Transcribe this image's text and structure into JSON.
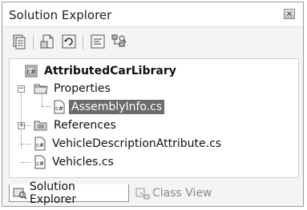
{
  "window": {
    "title": "Solution Explorer",
    "close_glyph": "×"
  },
  "toolbar": {
    "buttons": [
      {
        "icon": "properties-icon"
      },
      {
        "icon": "show-all-files-icon"
      },
      {
        "icon": "refresh-icon"
      },
      {
        "icon": "view-code-icon"
      },
      {
        "icon": "class-diagram-icon"
      }
    ]
  },
  "tree": {
    "project": "AttributedCarLibrary",
    "properties": "Properties",
    "assemblyinfo": "AssemblyInfo.cs",
    "references": "References",
    "file1": "VehicleDescriptionAttribute.cs",
    "file2": "Vehicles.cs",
    "collapse_glyph": "−",
    "expand_glyph": "+"
  },
  "tabs": {
    "solution_explorer": "Solution Explorer",
    "class_view": "Class View"
  },
  "colors": {
    "selection": "#6b6b6b",
    "border": "#9a9a9a"
  }
}
